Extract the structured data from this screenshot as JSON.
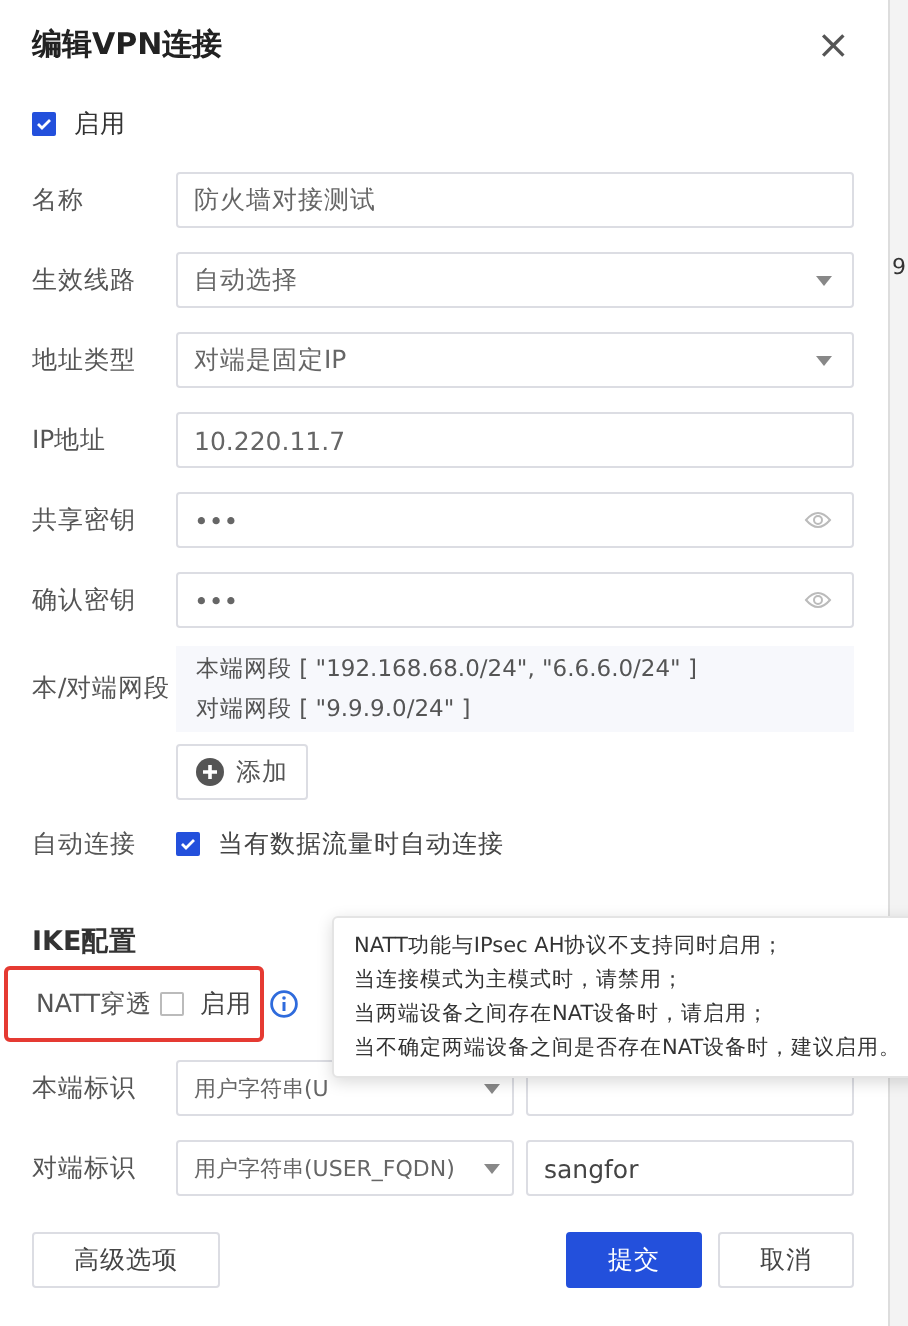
{
  "dialog": {
    "title": "编辑VPN连接",
    "close": "×"
  },
  "enable": {
    "label": "启用",
    "checked": true
  },
  "fields": [
    {
      "kind": "text",
      "label": "名称",
      "value": "防火墙对接测试"
    },
    {
      "kind": "select",
      "label": "生效线路",
      "value": "自动选择"
    },
    {
      "kind": "select",
      "label": "地址类型",
      "value": "对端是固定IP"
    },
    {
      "kind": "text",
      "label": "IP地址",
      "value": "10.220.11.7"
    },
    {
      "kind": "password",
      "label": "共享密钥",
      "value": "•••"
    },
    {
      "kind": "password",
      "label": "确认密钥",
      "value": "•••"
    }
  ],
  "networks": {
    "label": "本/对端网段",
    "lines": [
      "本端网段 [ \"192.168.68.0/24\", \"6.6.6.0/24\" ]",
      "对端网段 [ \"9.9.9.0/24\" ]"
    ],
    "add_button": "添加"
  },
  "auto_connect": {
    "label": "自动连接",
    "option": "当有数据流量时自动连接",
    "checked": true
  },
  "ike": {
    "heading": "IKE配置",
    "natt": {
      "label": "NATT穿透",
      "option": "启用",
      "checked": false,
      "highlighted": true
    },
    "identities": [
      {
        "label": "本端标识",
        "type": "用户字符串(U"
      },
      {
        "label": "对端标识",
        "type": "用户字符串(USER_FQDN)",
        "value": "sangfor"
      }
    ]
  },
  "tooltip": {
    "lines": [
      "NATT功能与IPsec AH协议不支持同时启用；",
      "当连接模式为主模式时，请禁用；",
      "当两端设备之间存在NAT设备时，请启用；",
      "当不确定两端设备之间是否存在NAT设备时，建议启用。"
    ]
  },
  "buttons": {
    "advanced": "高级选项",
    "submit": "提交",
    "cancel": "取消"
  },
  "background_page": {
    "text": "9"
  }
}
